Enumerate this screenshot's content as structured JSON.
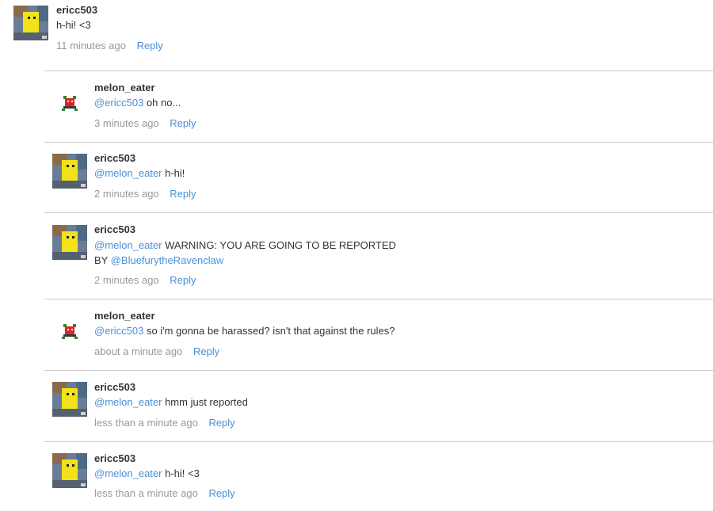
{
  "reply_label": "Reply",
  "top_comment": {
    "author": "ericc503",
    "text": "h-hi! <3",
    "time": "11 minutes ago",
    "avatar": "yellow-block-avatar"
  },
  "replies": [
    {
      "author": "melon_eater",
      "mention": "@ericc503",
      "text": " oh no...",
      "time": "3 minutes ago",
      "avatar": "red-creature-avatar"
    },
    {
      "author": "ericc503",
      "mention": "@melon_eater",
      "text": " h-hi!",
      "time": "2 minutes ago",
      "avatar": "yellow-block-avatar"
    },
    {
      "author": "ericc503",
      "mention": "@melon_eater",
      "text": " WARNING: YOU ARE GOING TO BE REPORTED",
      "text_line2": "BY ",
      "mention2": "@BluefurytheRavenclaw",
      "time": "2 minutes ago",
      "avatar": "yellow-block-avatar"
    },
    {
      "author": "melon_eater",
      "mention": "@ericc503",
      "text": " so i'm gonna be harassed? isn't that against the rules?",
      "time": "about a minute ago",
      "avatar": "red-creature-avatar"
    },
    {
      "author": "ericc503",
      "mention": "@melon_eater",
      "text": " hmm just reported",
      "time": "less than a minute ago",
      "avatar": "yellow-block-avatar"
    },
    {
      "author": "ericc503",
      "mention": "@melon_eater",
      "text": " h-hi! <3",
      "time": "less than a minute ago",
      "avatar": "yellow-block-avatar"
    }
  ],
  "colors": {
    "link": "#4a90d9",
    "text": "#333333",
    "muted": "#999999",
    "divider": "#cccccc"
  }
}
